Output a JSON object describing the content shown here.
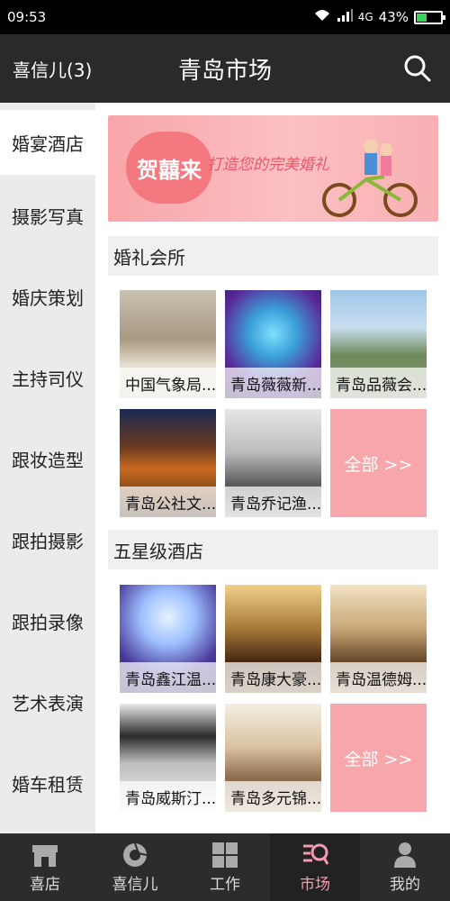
{
  "status": {
    "time": "09:53",
    "network": "4G",
    "battery": "43%",
    "battery_level": 0.43
  },
  "header": {
    "left_label": "喜信儿(3)",
    "title": "青岛市场",
    "search_icon": "search-icon"
  },
  "sidebar": {
    "items": [
      {
        "label": "婚宴酒店"
      },
      {
        "label": "摄影写真"
      },
      {
        "label": "婚庆策划"
      },
      {
        "label": "主持司仪"
      },
      {
        "label": "跟妆造型"
      },
      {
        "label": "跟拍摄影"
      },
      {
        "label": "跟拍录像"
      },
      {
        "label": "艺术表演"
      },
      {
        "label": "婚车租赁"
      }
    ]
  },
  "banner": {
    "logo_text": "贺囍来",
    "slogan": "打造您的完美婚礼"
  },
  "sections": [
    {
      "title": "婚礼会所",
      "tiles": [
        {
          "caption": "中国气象局..."
        },
        {
          "caption": "青岛薇薇新..."
        },
        {
          "caption": "青岛品薇会..."
        },
        {
          "caption": "青岛公社文..."
        },
        {
          "caption": "青岛乔记渔..."
        }
      ],
      "more_label": "全部 >>"
    },
    {
      "title": "五星级酒店",
      "tiles": [
        {
          "caption": "青岛鑫江温..."
        },
        {
          "caption": "青岛康大豪..."
        },
        {
          "caption": "青岛温德姆..."
        },
        {
          "caption": "青岛威斯汀..."
        },
        {
          "caption": "青岛多元锦..."
        }
      ],
      "more_label": "全部 >>"
    }
  ],
  "tabs": [
    {
      "label": "喜店",
      "icon": "shop-icon"
    },
    {
      "label": "喜信儿",
      "icon": "aperture-icon"
    },
    {
      "label": "工作",
      "icon": "grid-icon"
    },
    {
      "label": "市场",
      "icon": "market-search-icon"
    },
    {
      "label": "我的",
      "icon": "user-icon"
    }
  ],
  "colors": {
    "accent": "#f7a7ab",
    "active_tab": "#f39bb0",
    "topbar": "#2a2a2a"
  }
}
